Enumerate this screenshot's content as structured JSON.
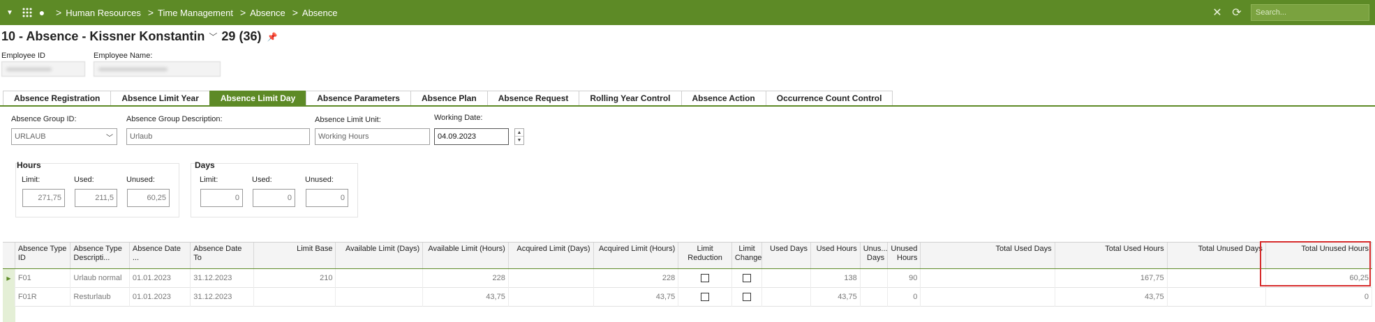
{
  "breadcrumb": [
    "Human Resources",
    "Time Management",
    "Absence",
    "Absence"
  ],
  "search": {
    "placeholder": "Search..."
  },
  "header": {
    "title": "10 - Absence - Kissner Konstantin",
    "count": "29 (36)"
  },
  "employee": {
    "id_label": "Employee ID",
    "name_label": "Employee Name:"
  },
  "tabs": [
    "Absence Registration",
    "Absence Limit Year",
    "Absence Limit Day",
    "Absence Parameters",
    "Absence Plan",
    "Absence Request",
    "Rolling Year Control",
    "Absence Action",
    "Occurrence Count Control"
  ],
  "active_tab": "Absence Limit Day",
  "form": {
    "group_id_label": "Absence Group ID:",
    "group_id_value": "URLAUB",
    "group_desc_label": "Absence Group Description:",
    "group_desc_value": "Urlaub",
    "limit_unit_label": "Absence Limit Unit:",
    "limit_unit_value": "Working Hours",
    "working_date_label": "Working Date:",
    "working_date_value": "04.09.2023"
  },
  "hours": {
    "title": "Hours",
    "limit_label": "Limit:",
    "used_label": "Used:",
    "unused_label": "Unused:",
    "limit": "271,75",
    "used": "211,5",
    "unused": "60,25"
  },
  "days": {
    "title": "Days",
    "limit_label": "Limit:",
    "used_label": "Used:",
    "unused_label": "Unused:",
    "limit": "0",
    "used": "0",
    "unused": "0"
  },
  "grid": {
    "headers": [
      "Absence Type ID",
      "Absence Type Descripti...",
      "Absence Date ...",
      "Absence Date To",
      "Limit Base",
      "Available Limit (Days)",
      "Available Limit (Hours)",
      "Acquired Limit (Days)",
      "Acquired Limit (Hours)",
      "Limit Reduction",
      "Limit Change",
      "Used Days",
      "Used Hours",
      "Unus... Days",
      "Unused Hours",
      "Total Used Days",
      "Total Used Hours",
      "Total Unused Days",
      "Total Unused Hours"
    ],
    "rows": [
      [
        "F01",
        "Urlaub normal",
        "01.01.2023",
        "31.12.2023",
        "210",
        "",
        "228",
        "",
        "228",
        "",
        "",
        "",
        "138",
        "",
        "90",
        "",
        "167,75",
        "",
        "60,25"
      ],
      [
        "F01R",
        "Resturlaub",
        "01.01.2023",
        "31.12.2023",
        "",
        "",
        "43,75",
        "",
        "43,75",
        "",
        "",
        "",
        "43,75",
        "",
        "0",
        "",
        "43,75",
        "",
        "0"
      ]
    ]
  }
}
